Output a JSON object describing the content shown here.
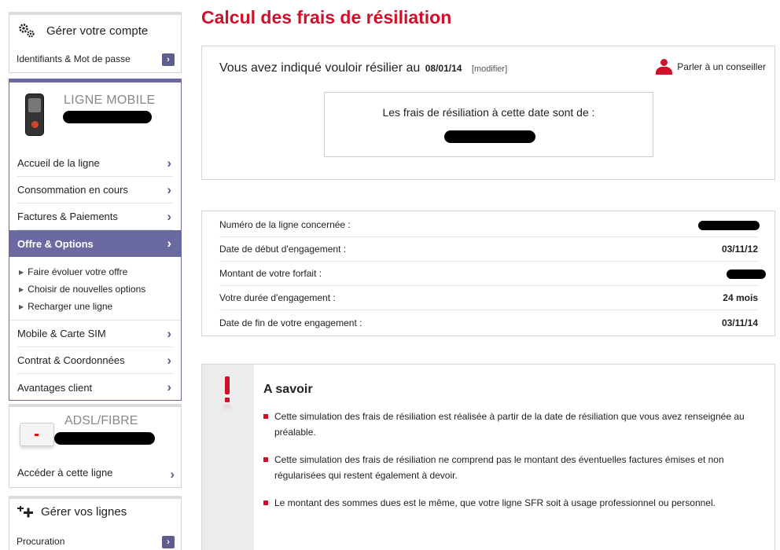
{
  "sidebar": {
    "account": {
      "title": "Gérer votre compte",
      "link": "Identifiants & Mot de passe",
      "icon": "gears-icon"
    },
    "mobile": {
      "title": "LIGNE MOBILE",
      "nav": [
        {
          "label": "Accueil de la ligne",
          "active": false
        },
        {
          "label": "Consommation en cours",
          "active": false
        },
        {
          "label": "Factures & Paiements",
          "active": false
        },
        {
          "label": "Offre & Options",
          "active": true
        }
      ],
      "subnav": [
        {
          "label": "Faire évoluer votre offre"
        },
        {
          "label": "Choisir de nouvelles options"
        },
        {
          "label": "Recharger une ligne"
        }
      ],
      "nav_after": [
        {
          "label": "Mobile & Carte SIM"
        },
        {
          "label": "Contrat & Coordonnées"
        },
        {
          "label": "Avantages client"
        }
      ]
    },
    "adsl": {
      "title": "ADSL/FIBRE",
      "link": "Accéder à cette ligne"
    },
    "lines": {
      "title": "Gérer vos lignes",
      "link": "Procuration"
    }
  },
  "main": {
    "title": "Calcul des frais de résiliation",
    "resiliation": {
      "text": "Vous avez indiqué vouloir résilier au",
      "date": "08/01/14",
      "modify": "[modifier]",
      "advisor": "Parler à un conseiller"
    },
    "fees": {
      "label": "Les frais de résiliation à cette date sont de :"
    },
    "info": [
      {
        "label": "Numéro de la ligne concernée :",
        "value": ""
      },
      {
        "label": "Date de début d'engagement :",
        "value": "03/11/12"
      },
      {
        "label": "Montant de votre forfait :",
        "value": ""
      },
      {
        "label": "Votre durée d'engagement :",
        "value": "24 mois"
      },
      {
        "label": "Date de fin de votre engagement :",
        "value": "03/11/14"
      }
    ],
    "savoir": {
      "title": "A savoir",
      "bullets": [
        "Cette simulation des frais de résiliation est réalisée à partir de la date de résiliation que vous avez renseignée au préalable.",
        "Cette simulation des frais de résiliation ne comprend pas le montant des éventuelles factures émises et non régularisées qui restent également à devoir.",
        "Le montant des sommes dues est le même, que votre ligne SFR soit à usage professionnel ou personnel."
      ]
    }
  },
  "colors": {
    "accent": "#d0102a",
    "nav_active": "#6a6aa0",
    "chevron": "#5e5e8e"
  }
}
